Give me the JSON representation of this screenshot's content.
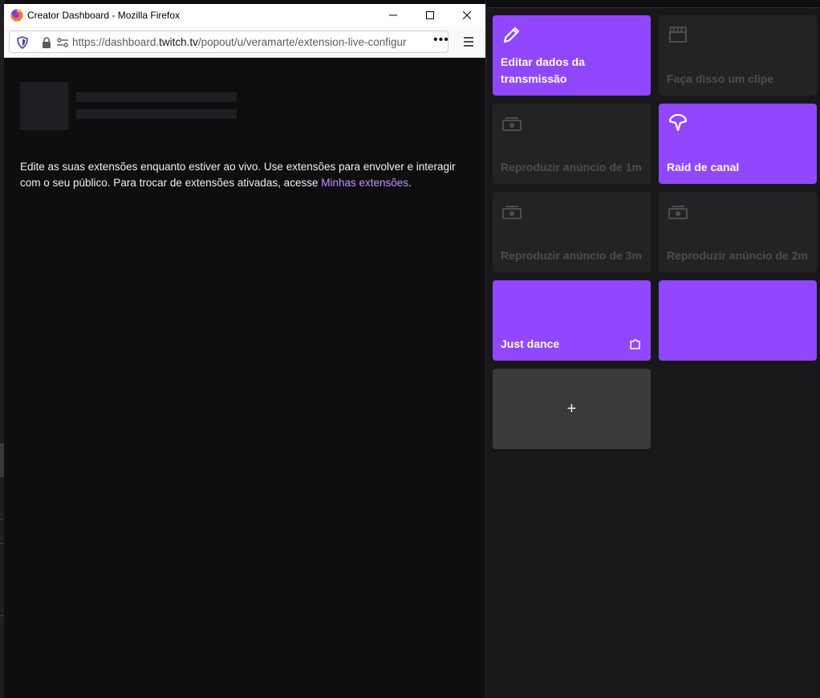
{
  "window": {
    "title": "Creator Dashboard - Mozilla Firefox",
    "url_prefix": "https://dashboard.",
    "url_host": "twitch.tv",
    "url_path": "/popout/u/veramarte/extension-live-configur",
    "more_label": "•••"
  },
  "content": {
    "description_before": "Edite as suas extensões enquanto estiver ao vivo. Use extensões para envolver e interagir com o seu público. Para trocar de extensões ativadas, acesse ",
    "description_link": "Minhas extensões",
    "description_after": "."
  },
  "quick_actions": [
    {
      "label": "Editar dados da transmissão",
      "icon": "pencil-icon",
      "state": "active"
    },
    {
      "label": "Faça disso um clipe",
      "icon": "clapperboard-icon",
      "state": "disabled"
    },
    {
      "label": "Reproduzir anúncio de 1m",
      "icon": "ad-icon",
      "state": "disabled"
    },
    {
      "label": "Raid de canal",
      "icon": "raid-icon",
      "state": "active"
    },
    {
      "label": "Reproduzir anúncio de 3m",
      "icon": "ad-icon",
      "state": "disabled"
    },
    {
      "label": "Reproduzir anúncio de 2m",
      "icon": "ad-icon",
      "state": "disabled"
    },
    {
      "label": "Just dance",
      "icon": "extension-puzzle-icon",
      "state": "active"
    },
    {
      "label": "",
      "icon": "",
      "state": "active"
    },
    {
      "label": "+",
      "icon": "plus-icon",
      "state": "add"
    }
  ],
  "colors": {
    "accent": "#9147ff",
    "link": "#bf94ff",
    "background": "#0e0e10",
    "tile_disabled": "#232326"
  }
}
